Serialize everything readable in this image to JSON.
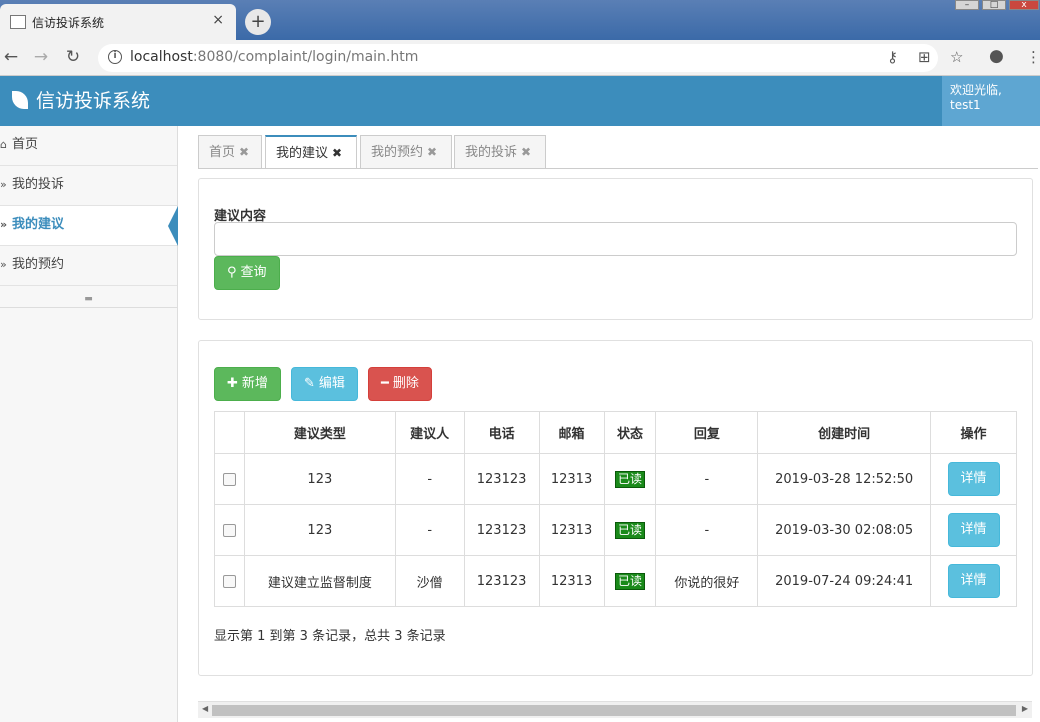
{
  "browser": {
    "tab_title": "信访投诉系统",
    "tab_close": "×",
    "new_tab": "+",
    "url_host": "localhost",
    "url_rest": ":8080/complaint/login/main.htm"
  },
  "header": {
    "title": "信访投诉系统",
    "welcome_line1": "欢迎光临,",
    "welcome_line2": "test1"
  },
  "sidebar": {
    "items": [
      {
        "label": "首页",
        "icon": "home-icon"
      },
      {
        "label": "我的投诉",
        "icon": "double-chevron-icon"
      },
      {
        "label": "我的建议",
        "icon": "double-chevron-icon",
        "active": true
      },
      {
        "label": "我的预约",
        "icon": "double-chevron-icon"
      }
    ]
  },
  "tabs": [
    {
      "label": "首页"
    },
    {
      "label": "我的建议",
      "active": true
    },
    {
      "label": "我的预约"
    },
    {
      "label": "我的投诉"
    }
  ],
  "search": {
    "label": "建议内容",
    "value": "",
    "query_button": "查询"
  },
  "toolbar": {
    "add_label": "新增",
    "edit_label": "编辑",
    "delete_label": "删除"
  },
  "table": {
    "columns": [
      "建议类型",
      "建议人",
      "电话",
      "邮箱",
      "状态",
      "回复",
      "创建时间",
      "操作"
    ],
    "rows": [
      {
        "type": "123",
        "person": "-",
        "phone": "123123",
        "email": "12313",
        "status": "已读",
        "reply": "-",
        "created": "2019-03-28 12:52:50",
        "action": "详情"
      },
      {
        "type": "123",
        "person": "-",
        "phone": "123123",
        "email": "12313",
        "status": "已读",
        "reply": "-",
        "created": "2019-03-30 02:08:05",
        "action": "详情"
      },
      {
        "type": "建议建立监督制度",
        "person": "沙僧",
        "phone": "123123",
        "email": "12313",
        "status": "已读",
        "reply": "你说的很好",
        "created": "2019-07-24 09:24:41",
        "action": "详情"
      }
    ]
  },
  "pager": {
    "summary": "显示第 1 到第 3 条记录，总共 3 条记录"
  },
  "colors": {
    "header_blue": "#3c8dbc",
    "success": "#5cb85c",
    "info": "#5bc0de",
    "danger": "#d9534f",
    "status_green": "#1a8a1a"
  }
}
